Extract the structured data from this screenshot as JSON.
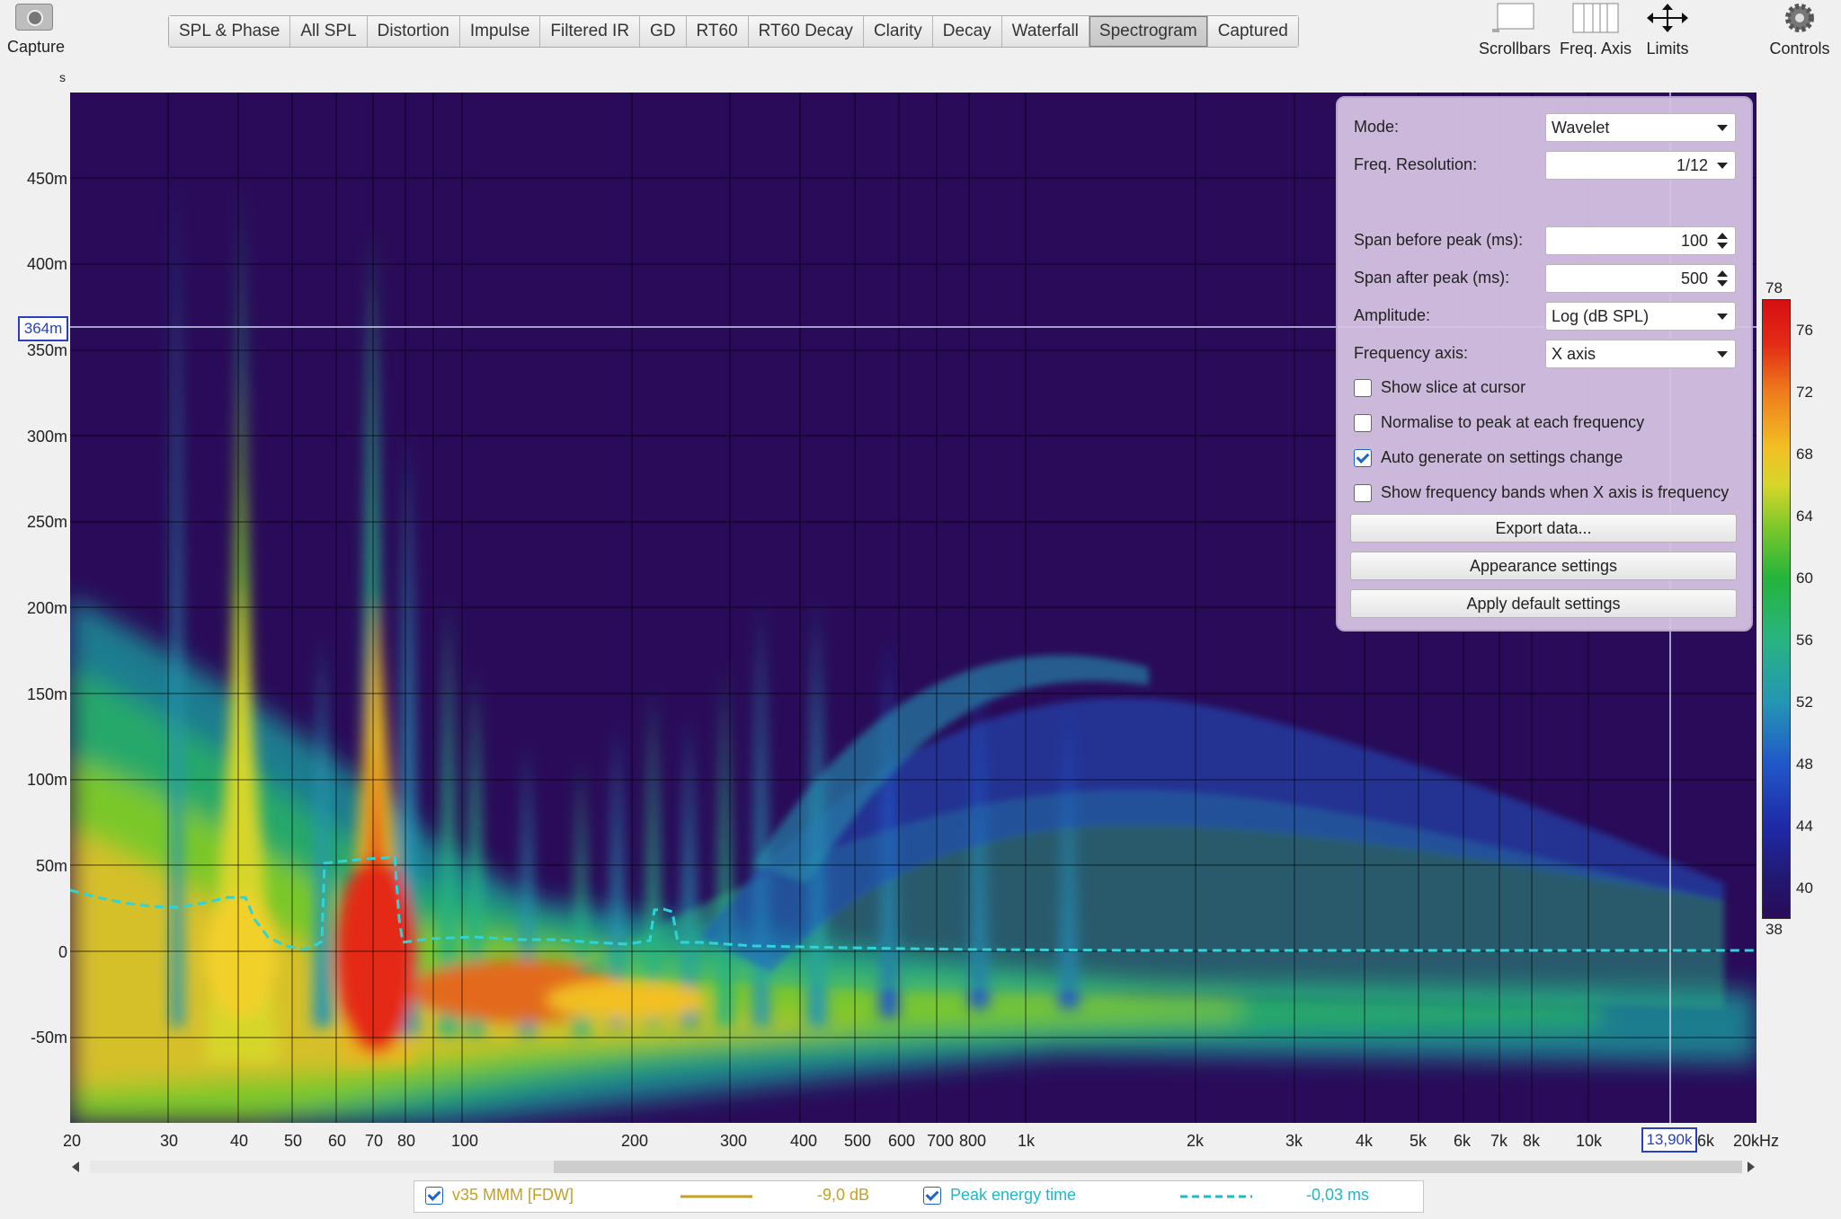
{
  "toolbar": {
    "capture_label": "Capture",
    "tabs": [
      "SPL & Phase",
      "All SPL",
      "Distortion",
      "Impulse",
      "Filtered IR",
      "GD",
      "RT60",
      "RT60 Decay",
      "Clarity",
      "Decay",
      "Waterfall",
      "Spectrogram",
      "Captured"
    ],
    "active_tab": "Spectrogram",
    "scrollbars_label": "Scrollbars",
    "freq_axis_label": "Freq. Axis",
    "limits_label": "Limits",
    "controls_label": "Controls"
  },
  "chart_data": {
    "type": "heatmap",
    "y_unit": "s",
    "y_ticks": [
      "450m",
      "400m",
      "350m",
      "300m",
      "250m",
      "200m",
      "150m",
      "100m",
      "50m",
      "0",
      "-50m"
    ],
    "y_cursor_label": "364m",
    "x_ticks": [
      "20",
      "30",
      "40",
      "50",
      "60",
      "70",
      "80",
      "100",
      "200",
      "300",
      "400",
      "500",
      "600",
      "700",
      "800",
      "1k",
      "2k",
      "3k",
      "4k",
      "5k",
      "6k",
      "7k",
      "8k",
      "10k",
      "6k",
      "20kHz"
    ],
    "x_cursor_label": "13,90k",
    "colorbar_ticks": [
      "78",
      "76",
      "72",
      "68",
      "64",
      "60",
      "56",
      "52",
      "48",
      "44",
      "40",
      "38"
    ],
    "colors": {
      "background": "#2a0b59",
      "peak_line": "#2fd3d8",
      "cursor": "#c8d8e8"
    }
  },
  "panel": {
    "mode_label": "Mode:",
    "mode_value": "Wavelet",
    "freq_res_label": "Freq. Resolution:",
    "freq_res_value": "1/12",
    "span_before_label": "Span before peak (ms):",
    "span_before_value": "100",
    "span_after_label": "Span after peak (ms):",
    "span_after_value": "500",
    "amplitude_label": "Amplitude:",
    "amplitude_value": "Log (dB SPL)",
    "freq_axis_label": "Frequency axis:",
    "freq_axis_value": "X axis",
    "checkboxes": [
      {
        "label": "Show slice at cursor",
        "checked": false
      },
      {
        "label": "Normalise to peak at each frequency",
        "checked": false
      },
      {
        "label": "Auto generate on settings change",
        "checked": true
      },
      {
        "label": "Show frequency bands when X axis is frequency",
        "checked": false
      }
    ],
    "export_label": "Export data...",
    "appearance_label": "Appearance settings",
    "defaults_label": "Apply default settings"
  },
  "legend": {
    "trace_name": "v35 MMM [FDW]",
    "trace_value": "-9,0 dB",
    "trace_color": "#c8a021",
    "peak_name": "Peak energy time",
    "peak_value": "-0,03 ms",
    "peak_color": "#20b8c8"
  }
}
